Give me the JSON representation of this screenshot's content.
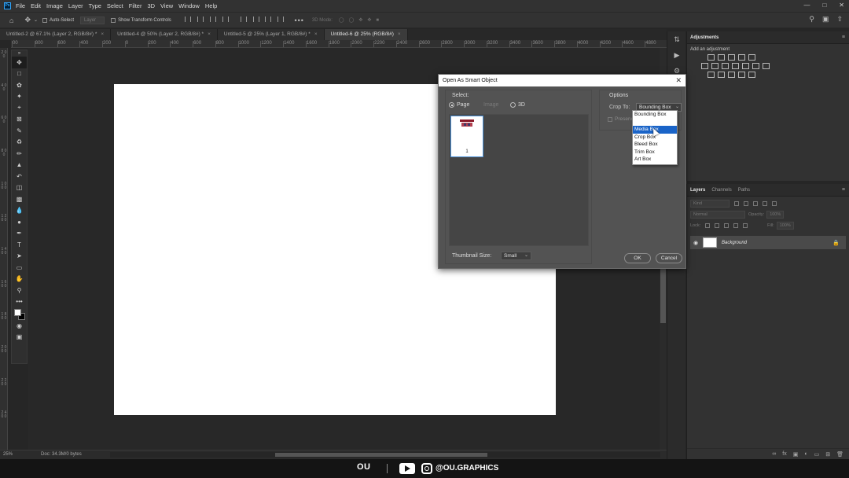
{
  "menubar": {
    "logo": "Ps",
    "items": [
      "File",
      "Edit",
      "Image",
      "Layer",
      "Type",
      "Select",
      "Filter",
      "3D",
      "View",
      "Window",
      "Help"
    ]
  },
  "optionsbar": {
    "auto_select": "Auto-Select",
    "layer_select": "Layer",
    "show_transform": "Show Transform Controls",
    "mode_3d": "3D Mode:"
  },
  "tabs": [
    {
      "label": "Untitled-2 @ 67.1% (Layer 2, RGB/8#) *",
      "active": false
    },
    {
      "label": "Untitled-4 @ 50% (Layer 2, RGB/8#) *",
      "active": false
    },
    {
      "label": "Untitled-5 @ 25% (Layer 1, RGB/8#) *",
      "active": false
    },
    {
      "label": "Untitled-6 @ 25% (RGB/8#)",
      "active": true
    }
  ],
  "ruler_h": [
    "00",
    "800",
    "600",
    "400",
    "200",
    "0",
    "200",
    "400",
    "600",
    "800",
    "1000",
    "1200",
    "1400",
    "1600",
    "1800",
    "2000",
    "2200",
    "2400",
    "2600",
    "2800",
    "3000",
    "3200",
    "3400",
    "3600",
    "3800",
    "4000",
    "4200",
    "4600",
    "4800"
  ],
  "ruler_v": [
    "2 0 0",
    "4 0 0",
    "6 0 0",
    "8 0 0",
    "1 0 0 0",
    "1 2 0 0",
    "1 4 0 0",
    "1 6 0 0",
    "1 8 0 0",
    "2 0 0 0",
    "2 2 0 0",
    "2 4 0 0"
  ],
  "statusbar": {
    "zoom": "25%",
    "doc_info": "Doc: 34.3M/0 bytes"
  },
  "adjustments": {
    "title": "Adjustments",
    "subtitle": "Add an adjustment"
  },
  "layers": {
    "tabs": [
      "Layers",
      "Channels",
      "Paths"
    ],
    "kind": "Kind",
    "blend_mode": "Normal",
    "opacity_label": "Opacity:",
    "opacity_value": "100%",
    "lock_label": "Lock:",
    "fill_label": "Fill:",
    "fill_value": "100%",
    "background_layer": "Background"
  },
  "dialog": {
    "title": "Open As Smart Object",
    "select_label": "Select:",
    "radio_page": "Page",
    "radio_image": "Image",
    "radio_3d": "3D",
    "page_number": "1",
    "thumbnail_size_label": "Thumbnail Size:",
    "thumbnail_size_value": "Small",
    "options_label": "Options",
    "crop_to_label": "Crop To:",
    "crop_to_value": "Bounding Box",
    "preserve_label": "Preserv",
    "ok": "OK",
    "cancel": "Cancel"
  },
  "crop_dropdown": {
    "options": [
      "Bounding Box",
      "Media Box",
      "Crop Box",
      "Bleed Box",
      "Trim Box",
      "Art Box"
    ],
    "selected": "Media Box"
  },
  "branding": {
    "logo": "OU",
    "handle": "@OU.GRAPHICS"
  },
  "colors": {
    "accent": "#1a64c8",
    "workspace": "#282828",
    "panel": "#323232"
  }
}
